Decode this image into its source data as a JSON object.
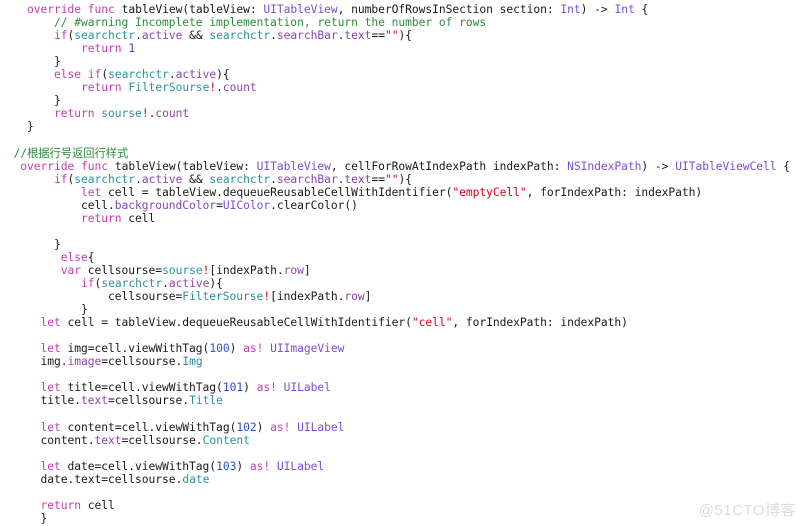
{
  "editor": {
    "language": "Swift",
    "background_color": "#ffffff",
    "font_size_px": 11.3,
    "line_height_px": 13.05,
    "colors": {
      "keyword": "#C53DB0",
      "type": "#7B4FD4",
      "property": "#8E44AD",
      "identifier": "#2A93A0",
      "string": "#D0021B",
      "number": "#2B50C8",
      "comment": "#2E8B3D",
      "plain": "#1a1a1a",
      "watermark": "#d9dde1"
    }
  },
  "watermark": {
    "text": "@51CTO博客"
  },
  "code": {
    "lines": [
      [
        {
          "t": "    ",
          "c": "plain"
        },
        {
          "t": "override",
          "c": "kw"
        },
        {
          "t": " ",
          "c": "plain"
        },
        {
          "t": "func",
          "c": "kw"
        },
        {
          "t": " tableView(tableView: ",
          "c": "plain"
        },
        {
          "t": "UITableView",
          "c": "typ"
        },
        {
          "t": ", numberOfRowsInSection section: ",
          "c": "plain"
        },
        {
          "t": "Int",
          "c": "typ"
        },
        {
          "t": ") -> ",
          "c": "plain"
        },
        {
          "t": "Int",
          "c": "typ"
        },
        {
          "t": " {",
          "c": "plain"
        }
      ],
      [
        {
          "t": "        ",
          "c": "plain"
        },
        {
          "t": "// #warning Incomplete implementation, return the number of rows",
          "c": "cmt"
        }
      ],
      [
        {
          "t": "        ",
          "c": "plain"
        },
        {
          "t": "if",
          "c": "kw"
        },
        {
          "t": "(",
          "c": "plain"
        },
        {
          "t": "searchctr",
          "c": "id"
        },
        {
          "t": ".",
          "c": "plain"
        },
        {
          "t": "active",
          "c": "prop"
        },
        {
          "t": " && ",
          "c": "plain"
        },
        {
          "t": "searchctr",
          "c": "id"
        },
        {
          "t": ".",
          "c": "plain"
        },
        {
          "t": "searchBar",
          "c": "prop"
        },
        {
          "t": ".",
          "c": "plain"
        },
        {
          "t": "text",
          "c": "prop"
        },
        {
          "t": "==",
          "c": "plain"
        },
        {
          "t": "\"\"",
          "c": "str"
        },
        {
          "t": "){",
          "c": "plain"
        }
      ],
      [
        {
          "t": "            ",
          "c": "plain"
        },
        {
          "t": "return",
          "c": "kw"
        },
        {
          "t": " ",
          "c": "plain"
        },
        {
          "t": "1",
          "c": "num"
        }
      ],
      [
        {
          "t": "        }",
          "c": "plain"
        }
      ],
      [
        {
          "t": "        ",
          "c": "plain"
        },
        {
          "t": "else",
          "c": "kw"
        },
        {
          "t": " ",
          "c": "plain"
        },
        {
          "t": "if",
          "c": "kw"
        },
        {
          "t": "(",
          "c": "plain"
        },
        {
          "t": "searchctr",
          "c": "id"
        },
        {
          "t": ".",
          "c": "plain"
        },
        {
          "t": "active",
          "c": "prop"
        },
        {
          "t": "){",
          "c": "plain"
        }
      ],
      [
        {
          "t": "            ",
          "c": "plain"
        },
        {
          "t": "return",
          "c": "kw"
        },
        {
          "t": " ",
          "c": "plain"
        },
        {
          "t": "FilterSourse",
          "c": "id"
        },
        {
          "t": "!",
          "c": "bang"
        },
        {
          "t": ".",
          "c": "plain"
        },
        {
          "t": "count",
          "c": "prop"
        }
      ],
      [
        {
          "t": "        }",
          "c": "plain"
        }
      ],
      [
        {
          "t": "        ",
          "c": "plain"
        },
        {
          "t": "return",
          "c": "kw"
        },
        {
          "t": " ",
          "c": "plain"
        },
        {
          "t": "sourse",
          "c": "id"
        },
        {
          "t": "!",
          "c": "bang"
        },
        {
          "t": ".",
          "c": "plain"
        },
        {
          "t": "count",
          "c": "prop"
        }
      ],
      [
        {
          "t": "    }",
          "c": "plain"
        }
      ],
      [],
      [
        {
          "t": "  ",
          "c": "plain"
        },
        {
          "t": "//根据行号返回行样式",
          "c": "cmt"
        }
      ],
      [
        {
          "t": "   ",
          "c": "plain"
        },
        {
          "t": "override",
          "c": "kw"
        },
        {
          "t": " ",
          "c": "plain"
        },
        {
          "t": "func",
          "c": "kw"
        },
        {
          "t": " tableView(tableView: ",
          "c": "plain"
        },
        {
          "t": "UITableView",
          "c": "typ"
        },
        {
          "t": ", cellForRowAtIndexPath indexPath: ",
          "c": "plain"
        },
        {
          "t": "NSIndexPath",
          "c": "typ"
        },
        {
          "t": ") -> ",
          "c": "plain"
        },
        {
          "t": "UITableViewCell",
          "c": "typ"
        },
        {
          "t": " {",
          "c": "plain"
        }
      ],
      [
        {
          "t": "        ",
          "c": "plain"
        },
        {
          "t": "if",
          "c": "kw"
        },
        {
          "t": "(",
          "c": "plain"
        },
        {
          "t": "searchctr",
          "c": "id"
        },
        {
          "t": ".",
          "c": "plain"
        },
        {
          "t": "active",
          "c": "prop"
        },
        {
          "t": " && ",
          "c": "plain"
        },
        {
          "t": "searchctr",
          "c": "id"
        },
        {
          "t": ".",
          "c": "plain"
        },
        {
          "t": "searchBar",
          "c": "prop"
        },
        {
          "t": ".",
          "c": "plain"
        },
        {
          "t": "text",
          "c": "prop"
        },
        {
          "t": "==",
          "c": "plain"
        },
        {
          "t": "\"\"",
          "c": "str"
        },
        {
          "t": "){",
          "c": "plain"
        }
      ],
      [
        {
          "t": "            ",
          "c": "plain"
        },
        {
          "t": "let",
          "c": "kw"
        },
        {
          "t": " cell = tableView.dequeueReusableCellWithIdentifier(",
          "c": "plain"
        },
        {
          "t": "\"emptyCell\"",
          "c": "str"
        },
        {
          "t": ", forIndexPath: indexPath)",
          "c": "plain"
        }
      ],
      [
        {
          "t": "            cell.",
          "c": "plain"
        },
        {
          "t": "backgroundColor",
          "c": "prop"
        },
        {
          "t": "=",
          "c": "plain"
        },
        {
          "t": "UIColor",
          "c": "typ"
        },
        {
          "t": ".clearColor()",
          "c": "plain"
        }
      ],
      [
        {
          "t": "            ",
          "c": "plain"
        },
        {
          "t": "return",
          "c": "kw"
        },
        {
          "t": " cell",
          "c": "plain"
        }
      ],
      [],
      [
        {
          "t": "        }",
          "c": "plain"
        }
      ],
      [
        {
          "t": "         ",
          "c": "plain"
        },
        {
          "t": "else",
          "c": "kw"
        },
        {
          "t": "{",
          "c": "plain"
        }
      ],
      [
        {
          "t": "         ",
          "c": "plain"
        },
        {
          "t": "var",
          "c": "kw"
        },
        {
          "t": " cellsourse=",
          "c": "plain"
        },
        {
          "t": "sourse",
          "c": "id"
        },
        {
          "t": "!",
          "c": "bang"
        },
        {
          "t": "[indexPath.",
          "c": "plain"
        },
        {
          "t": "row",
          "c": "prop"
        },
        {
          "t": "]",
          "c": "plain"
        }
      ],
      [
        {
          "t": "            ",
          "c": "plain"
        },
        {
          "t": "if",
          "c": "kw"
        },
        {
          "t": "(",
          "c": "plain"
        },
        {
          "t": "searchctr",
          "c": "id"
        },
        {
          "t": ".",
          "c": "plain"
        },
        {
          "t": "active",
          "c": "prop"
        },
        {
          "t": "){",
          "c": "plain"
        }
      ],
      [
        {
          "t": "                cellsourse=",
          "c": "plain"
        },
        {
          "t": "FilterSourse",
          "c": "id"
        },
        {
          "t": "!",
          "c": "bang"
        },
        {
          "t": "[indexPath.",
          "c": "plain"
        },
        {
          "t": "row",
          "c": "prop"
        },
        {
          "t": "]",
          "c": "plain"
        }
      ],
      [
        {
          "t": "            }",
          "c": "plain"
        }
      ],
      [
        {
          "t": "      ",
          "c": "plain"
        },
        {
          "t": "let",
          "c": "kw"
        },
        {
          "t": " cell = tableView.dequeueReusableCellWithIdentifier(",
          "c": "plain"
        },
        {
          "t": "\"cell\"",
          "c": "str"
        },
        {
          "t": ", forIndexPath: indexPath)",
          "c": "plain"
        }
      ],
      [],
      [
        {
          "t": "      ",
          "c": "plain"
        },
        {
          "t": "let",
          "c": "kw"
        },
        {
          "t": " img=cell.viewWithTag(",
          "c": "plain"
        },
        {
          "t": "100",
          "c": "num"
        },
        {
          "t": ") ",
          "c": "plain"
        },
        {
          "t": "as!",
          "c": "kw"
        },
        {
          "t": " ",
          "c": "plain"
        },
        {
          "t": "UIImageView",
          "c": "typ"
        }
      ],
      [
        {
          "t": "      img.",
          "c": "plain"
        },
        {
          "t": "image",
          "c": "prop"
        },
        {
          "t": "=cellsourse.",
          "c": "plain"
        },
        {
          "t": "Img",
          "c": "id"
        }
      ],
      [],
      [
        {
          "t": "      ",
          "c": "plain"
        },
        {
          "t": "let",
          "c": "kw"
        },
        {
          "t": " title=cell.viewWithTag(",
          "c": "plain"
        },
        {
          "t": "101",
          "c": "num"
        },
        {
          "t": ") ",
          "c": "plain"
        },
        {
          "t": "as!",
          "c": "kw"
        },
        {
          "t": " ",
          "c": "plain"
        },
        {
          "t": "UILabel",
          "c": "typ"
        }
      ],
      [
        {
          "t": "      title.",
          "c": "plain"
        },
        {
          "t": "text",
          "c": "prop"
        },
        {
          "t": "=cellsourse.",
          "c": "plain"
        },
        {
          "t": "Title",
          "c": "id"
        }
      ],
      [],
      [
        {
          "t": "      ",
          "c": "plain"
        },
        {
          "t": "let",
          "c": "kw"
        },
        {
          "t": " content=cell.viewWithTag(",
          "c": "plain"
        },
        {
          "t": "102",
          "c": "num"
        },
        {
          "t": ") ",
          "c": "plain"
        },
        {
          "t": "as!",
          "c": "kw"
        },
        {
          "t": " ",
          "c": "plain"
        },
        {
          "t": "UILabel",
          "c": "typ"
        }
      ],
      [
        {
          "t": "      content.",
          "c": "plain"
        },
        {
          "t": "text",
          "c": "prop"
        },
        {
          "t": "=cellsourse.",
          "c": "plain"
        },
        {
          "t": "Content",
          "c": "id"
        }
      ],
      [],
      [
        {
          "t": "      ",
          "c": "plain"
        },
        {
          "t": "let",
          "c": "kw"
        },
        {
          "t": " date=cell.viewWithTag(",
          "c": "plain"
        },
        {
          "t": "103",
          "c": "num"
        },
        {
          "t": ") ",
          "c": "plain"
        },
        {
          "t": "as!",
          "c": "kw"
        },
        {
          "t": " ",
          "c": "plain"
        },
        {
          "t": "UILabel",
          "c": "typ"
        }
      ],
      [
        {
          "t": "      date.",
          "c": "plain"
        },
        {
          "t": "text",
          "c": "plain"
        },
        {
          "t": "=cellsourse.",
          "c": "plain"
        },
        {
          "t": "date",
          "c": "id"
        }
      ],
      [],
      [
        {
          "t": "      ",
          "c": "plain"
        },
        {
          "t": "return",
          "c": "kw"
        },
        {
          "t": " cell",
          "c": "plain"
        }
      ],
      [
        {
          "t": "      }",
          "c": "plain"
        }
      ]
    ]
  }
}
